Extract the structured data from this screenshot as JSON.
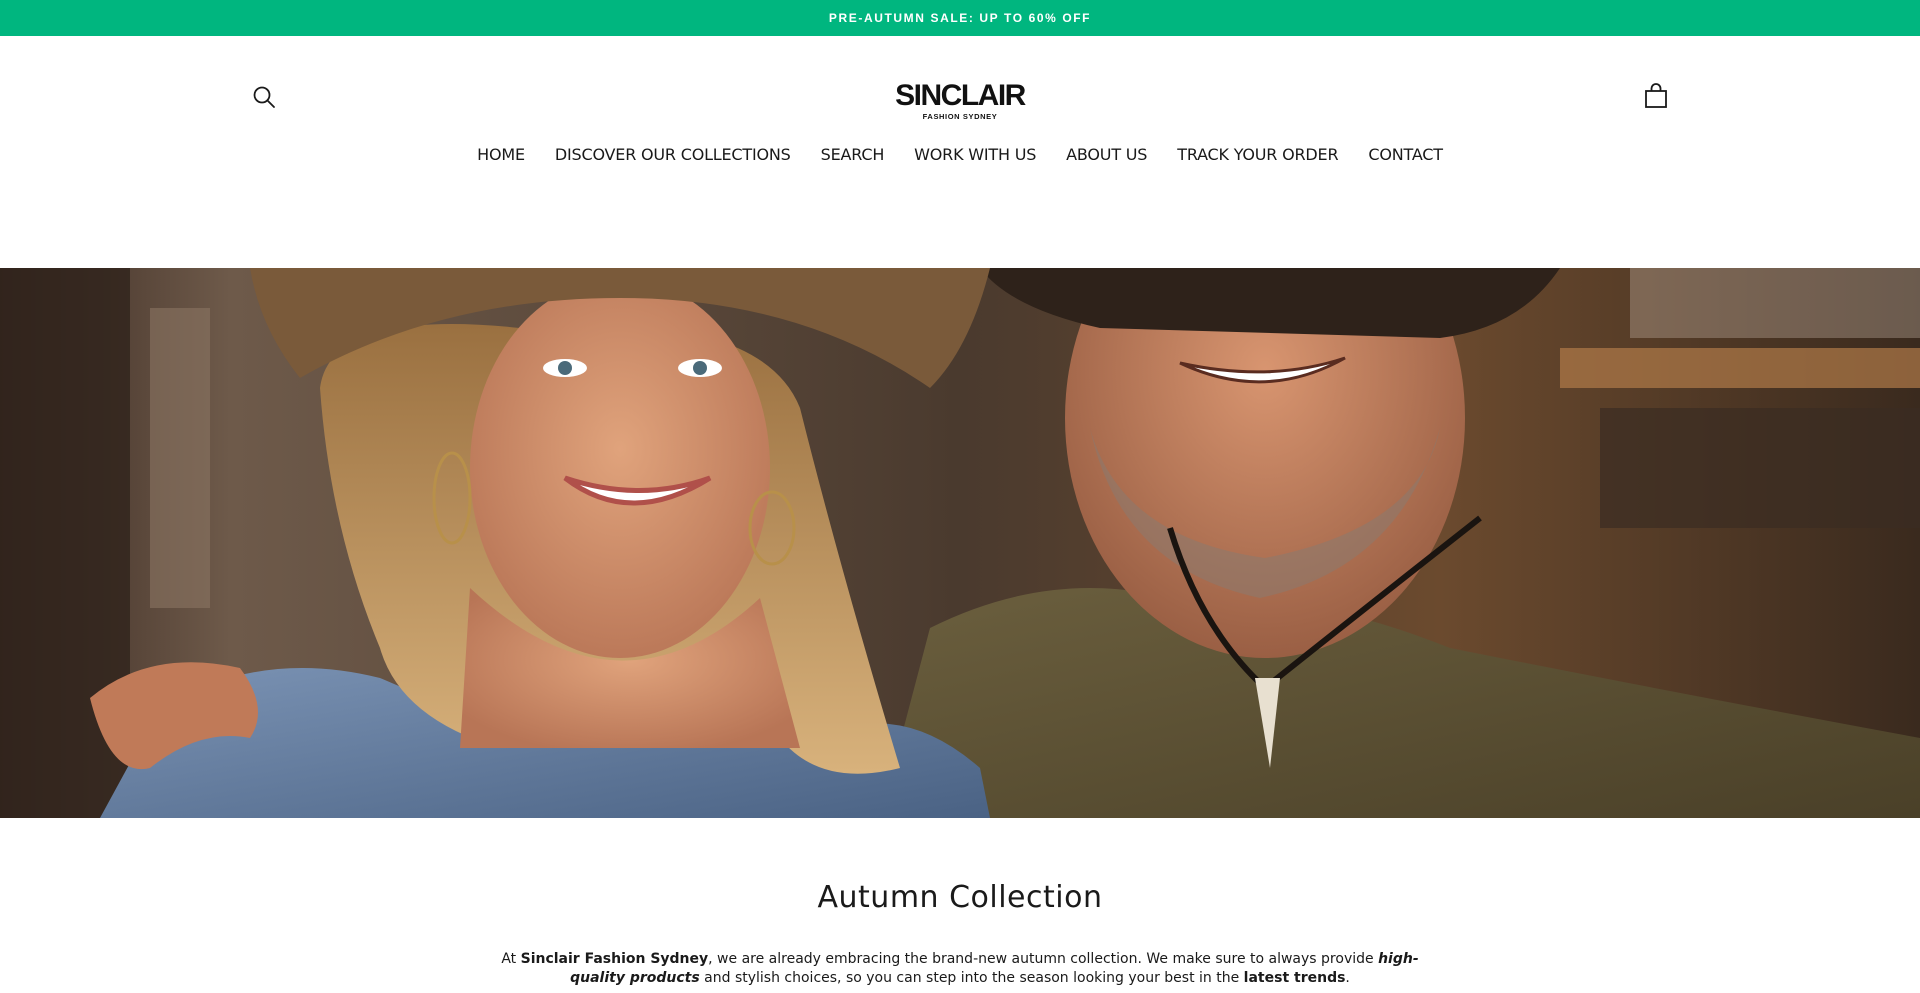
{
  "announcement": {
    "text": "PRE-AUTUMN SALE: UP TO 60% OFF"
  },
  "colors": {
    "announcement_bg": "#00b67f",
    "text": "#1a1a1a"
  },
  "header": {
    "search_icon": "search-icon",
    "cart_icon": "shopping-bag-icon",
    "logo": {
      "name": "SINCLAIR",
      "tagline": "FASHION SYDNEY"
    }
  },
  "nav": {
    "items": [
      {
        "label": "HOME"
      },
      {
        "label": "DISCOVER OUR COLLECTIONS"
      },
      {
        "label": "SEARCH"
      },
      {
        "label": "WORK WITH US"
      },
      {
        "label": "ABOUT US"
      },
      {
        "label": "TRACK YOUR ORDER"
      },
      {
        "label": "CONTACT"
      }
    ]
  },
  "collection": {
    "title": "Autumn Collection",
    "p1": "At ",
    "p2": "Sinclair Fashion Sydney",
    "p3": ", we are already embracing the brand-new autumn collection. We make sure to always provide ",
    "p4": "high-",
    "p5": "quality products",
    "p6": " and stylish choices, so you can step into the season looking your best in the ",
    "p7": "latest trends",
    "p8": "."
  }
}
